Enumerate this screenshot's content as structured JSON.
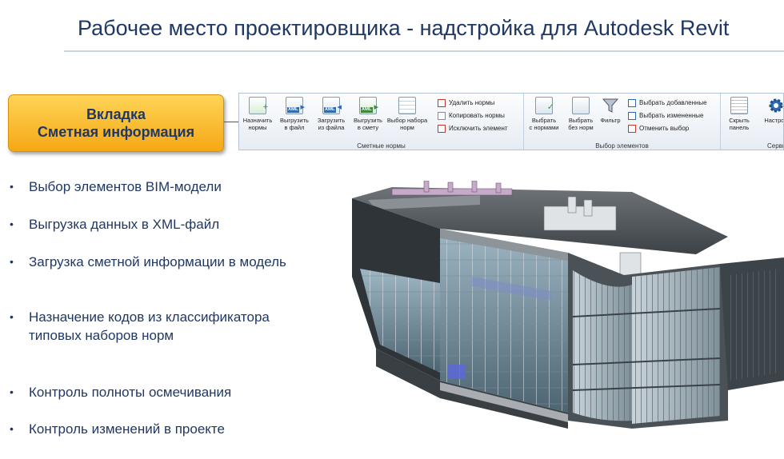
{
  "slide": {
    "title": "Рабочее место проектировщика - надстройка для Autodesk Revit"
  },
  "callout": {
    "line1": "Вкладка",
    "line2": "Сметная информация"
  },
  "ribbon": {
    "groups": [
      {
        "label": "Сметные нормы"
      },
      {
        "label": "Выбор элементов"
      },
      {
        "label": "Серви"
      }
    ],
    "buttons": [
      {
        "line1": "Назначить",
        "line2": "нормы"
      },
      {
        "line1": "Выгрузить",
        "line2": "в файл"
      },
      {
        "line1": "Загрузить",
        "line2": "из файла"
      },
      {
        "line1": "Выгрузить",
        "line2": "в смету"
      },
      {
        "line1": "Выбор набора",
        "line2": "норм"
      },
      {
        "line1": "Выбрать",
        "line2": "с нормами"
      },
      {
        "line1": "Выбрать",
        "line2": "без норм"
      },
      {
        "line1": "Фильтр",
        "line2": ""
      },
      {
        "line1": "Скрыть",
        "line2": "панель"
      },
      {
        "line1": "Настрой",
        "line2": ""
      }
    ],
    "small_buttons": [
      {
        "label": "Удалить нормы"
      },
      {
        "label": "Копировать нормы"
      },
      {
        "label": "Исключить элемент"
      },
      {
        "label": "Выбрать добавленные"
      },
      {
        "label": "Выбрать измененные"
      },
      {
        "label": "Отменить выбор"
      }
    ],
    "icon_tags": {
      "xml": "XML"
    }
  },
  "bullets": [
    "Выбор элементов BIM-модели",
    "Выгрузка данных в XML-файл",
    "Загрузка сметной информации в модель",
    "Назначение кодов из классификатора типовых наборов норм",
    "Контроль полноты осмечивания",
    "Контроль изменений в проекте"
  ],
  "colors": {
    "title": "#1f3864",
    "callout_fill": "#f5a815",
    "ribbon_accent": "#2e6db4"
  }
}
